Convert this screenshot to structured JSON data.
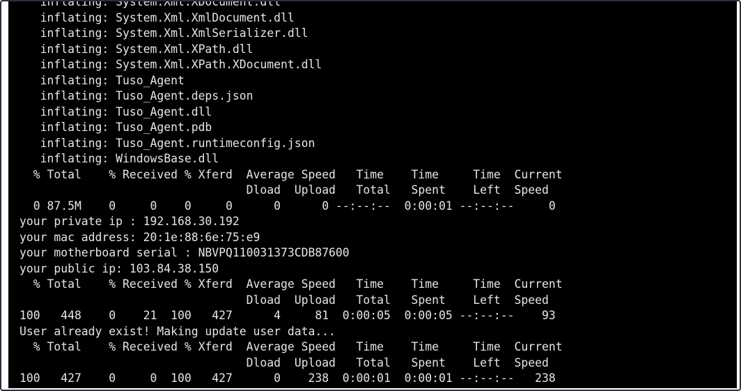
{
  "terminal": {
    "lines": [
      "   inflating: System.Xml.XDocument.dll",
      "   inflating: System.Xml.XmlDocument.dll",
      "   inflating: System.Xml.XmlSerializer.dll",
      "   inflating: System.Xml.XPath.dll",
      "   inflating: System.Xml.XPath.XDocument.dll",
      "   inflating: Tuso_Agent",
      "   inflating: Tuso_Agent.deps.json",
      "   inflating: Tuso_Agent.dll",
      "   inflating: Tuso_Agent.pdb",
      "   inflating: Tuso_Agent.runtimeconfig.json",
      "   inflating: WindowsBase.dll",
      "  % Total    % Received % Xferd  Average Speed   Time    Time     Time  Current",
      "                                 Dload  Upload   Total   Spent    Left  Speed",
      "  0 87.5M    0     0    0     0      0      0 --:--:--  0:00:01 --:--:--     0",
      "your private ip : 192.168.30.192",
      "your mac address: 20:1e:88:6e:75:e9",
      "your motherboard serial : NBVPQ110031373CDB87600",
      "your public ip: 103.84.38.150",
      "  % Total    % Received % Xferd  Average Speed   Time    Time     Time  Current",
      "                                 Dload  Upload   Total   Spent    Left  Speed",
      "100   448    0    21  100   427      4     81  0:00:05  0:00:05 --:--:--    93",
      "User already exist! Making update user data...",
      "  % Total    % Received % Xferd  Average Speed   Time    Time     Time  Current",
      "                                 Dload  Upload   Total   Spent    Left  Speed",
      "100   427    0     0  100   427      0    238  0:00:01  0:00:01 --:--:--   238"
    ]
  },
  "colors": {
    "background": "#000000",
    "foreground": "#e6e6e6",
    "frame": "#2a2f3a"
  }
}
